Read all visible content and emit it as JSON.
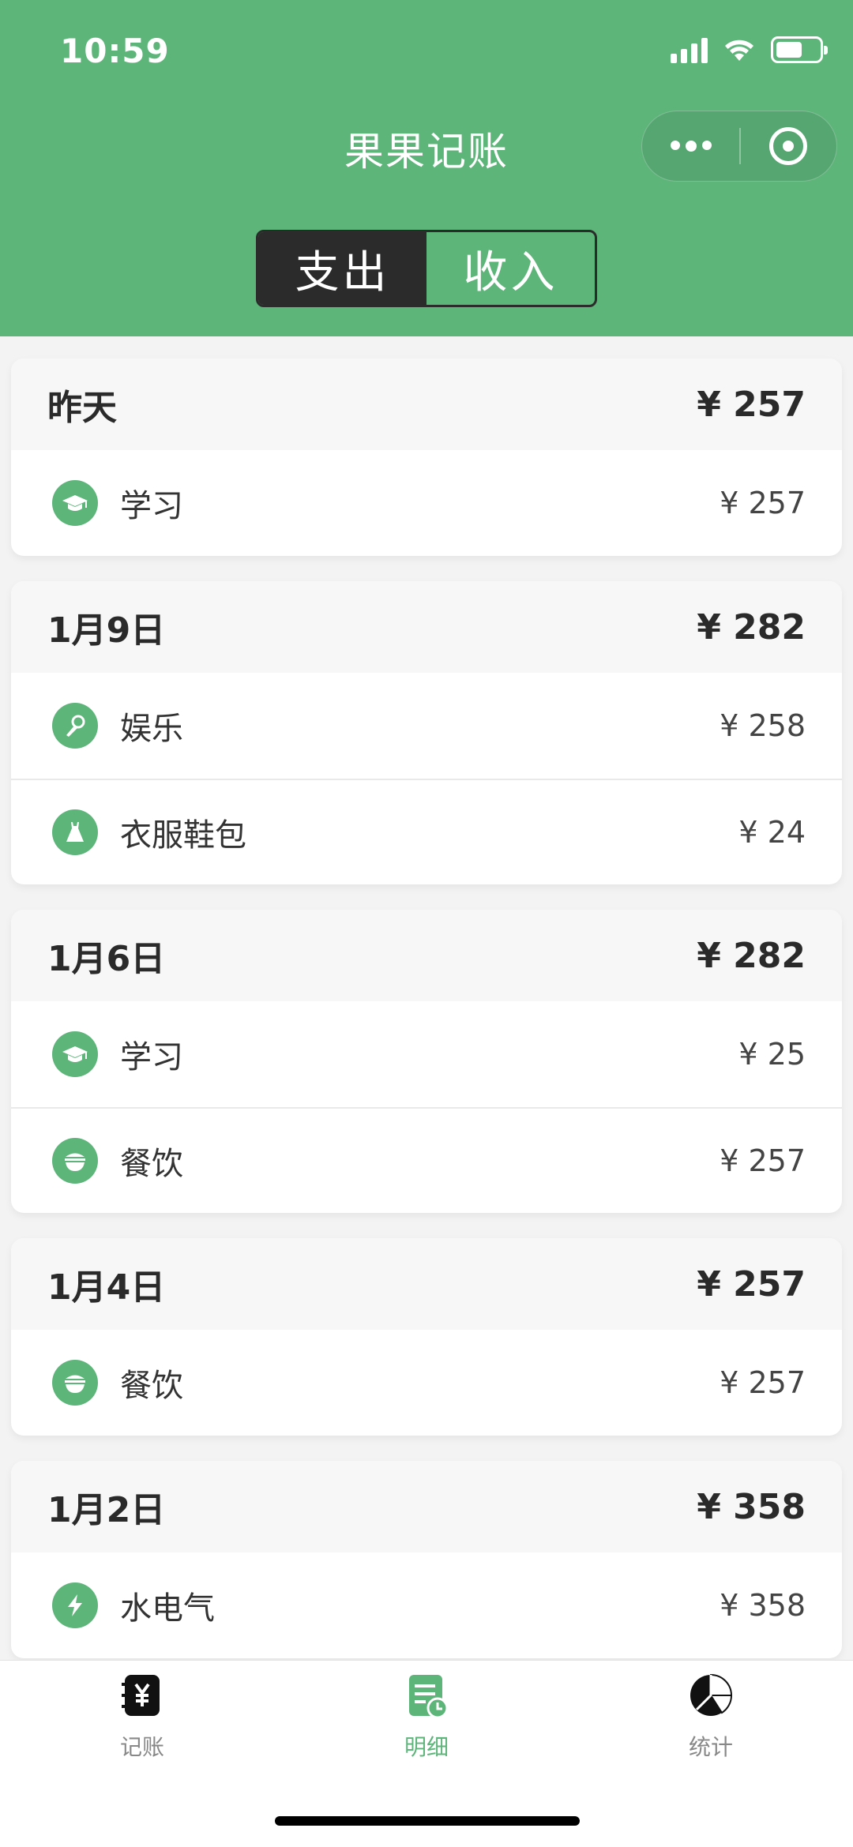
{
  "status": {
    "time": "10:59"
  },
  "header": {
    "title": "果果记账"
  },
  "segment": {
    "options": [
      "支出",
      "收入"
    ],
    "selected": "支出"
  },
  "groups": [
    {
      "date": "昨天",
      "total": "¥ 257",
      "items": [
        {
          "category": "学习",
          "icon": "graduation-cap-icon",
          "amount": "¥ 257"
        }
      ]
    },
    {
      "date": "1月9日",
      "total": "¥ 282",
      "items": [
        {
          "category": "娱乐",
          "icon": "microphone-icon",
          "amount": "¥ 258"
        },
        {
          "category": "衣服鞋包",
          "icon": "dress-icon",
          "amount": "¥ 24"
        }
      ]
    },
    {
      "date": "1月6日",
      "total": "¥ 282",
      "items": [
        {
          "category": "学习",
          "icon": "graduation-cap-icon",
          "amount": "¥ 25"
        },
        {
          "category": "餐饮",
          "icon": "bowl-icon",
          "amount": "¥ 257"
        }
      ]
    },
    {
      "date": "1月4日",
      "total": "¥ 257",
      "items": [
        {
          "category": "餐饮",
          "icon": "bowl-icon",
          "amount": "¥ 257"
        }
      ]
    },
    {
      "date": "1月2日",
      "total": "¥ 358",
      "items": [
        {
          "category": "水电气",
          "icon": "lightning-icon",
          "amount": "¥ 358"
        }
      ]
    }
  ],
  "tabbar": {
    "items": [
      {
        "label": "记账",
        "icon": "ledger-yen-icon"
      },
      {
        "label": "明细",
        "icon": "detail-list-clock-icon",
        "active": true
      },
      {
        "label": "统计",
        "icon": "pie-chart-icon"
      }
    ]
  },
  "colors": {
    "brand_green": "#5db57a",
    "segment_dark": "#2b2b2b"
  }
}
